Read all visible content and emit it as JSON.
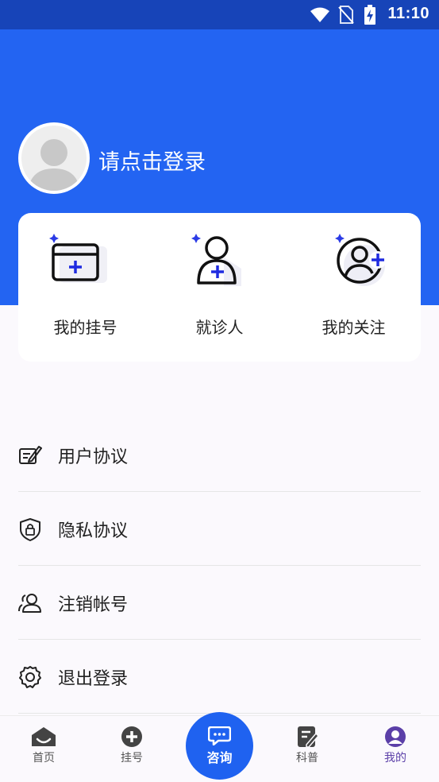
{
  "status_bar": {
    "time": "11:10",
    "icons": [
      "wifi-icon",
      "no-sim-icon",
      "battery-charging-icon"
    ]
  },
  "profile": {
    "login_prompt": "请点击登录",
    "avatar_icon": "default-avatar-icon"
  },
  "quick_actions": [
    {
      "label": "我的挂号",
      "icon": "registration-card-icon"
    },
    {
      "label": "就诊人",
      "icon": "patient-icon"
    },
    {
      "label": "我的关注",
      "icon": "follow-user-icon"
    }
  ],
  "menu": [
    {
      "label": "用户协议",
      "icon": "agreement-edit-icon"
    },
    {
      "label": "隐私协议",
      "icon": "privacy-shield-icon"
    },
    {
      "label": "注销帐号",
      "icon": "users-icon"
    },
    {
      "label": "退出登录",
      "icon": "logout-gear-icon"
    }
  ],
  "tabbar": {
    "items": [
      {
        "label": "首页",
        "icon": "home-icon",
        "active": false
      },
      {
        "label": "挂号",
        "icon": "plus-circle-icon",
        "active": false
      },
      {
        "label": "科普",
        "icon": "article-edit-icon",
        "active": false
      },
      {
        "label": "我的",
        "icon": "user-circle-icon",
        "active": true
      }
    ],
    "center": {
      "label": "咨询",
      "icon": "chat-bubble-icon"
    }
  },
  "colors": {
    "header_blue": "#2364f2",
    "status_blue": "#1744b8",
    "accent_blue": "#1f62f0",
    "active_purple": "#5b3fa8"
  }
}
